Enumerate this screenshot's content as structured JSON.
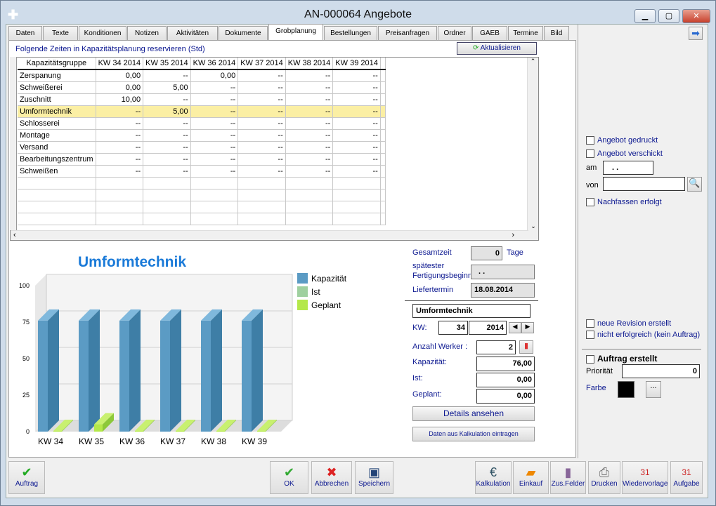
{
  "window": {
    "title": "AN-000064 Angebote"
  },
  "tabs": [
    "Daten",
    "Texte",
    "Konditionen",
    "Notizen",
    "Aktivitäten",
    "Dokumente",
    "Grobplanung",
    "Bestellungen",
    "Preisanfragen",
    "Ordner",
    "GAEB",
    "Termine",
    "Bild"
  ],
  "active_tab": "Grobplanung",
  "grob": {
    "caption": "Folgende Zeiten in Kapazitätsplanung reservieren (Std)",
    "refresh": "Aktualisieren"
  },
  "table": {
    "headers": [
      "Kapazitätsgruppe",
      "KW 34 2014",
      "KW 35 2014",
      "KW 36 2014",
      "KW 37 2014",
      "KW 38 2014",
      "KW 39 2014"
    ],
    "rows": [
      [
        "Zerspanung",
        "0,00",
        "--",
        "0,00",
        "--",
        "--",
        "--"
      ],
      [
        "Schweißerei",
        "0,00",
        "5,00",
        "--",
        "--",
        "--",
        "--"
      ],
      [
        "Zuschnitt",
        "10,00",
        "--",
        "--",
        "--",
        "--",
        "--"
      ],
      [
        "Umformtechnik",
        "--",
        "5,00",
        "--",
        "--",
        "--",
        "--"
      ],
      [
        "Schlosserei",
        "--",
        "--",
        "--",
        "--",
        "--",
        "--"
      ],
      [
        "Montage",
        "--",
        "--",
        "--",
        "--",
        "--",
        "--"
      ],
      [
        "Versand",
        "--",
        "--",
        "--",
        "--",
        "--",
        "--"
      ],
      [
        "Bearbeitungszentrum",
        "--",
        "--",
        "--",
        "--",
        "--",
        "--"
      ],
      [
        "Schweißen",
        "--",
        "--",
        "--",
        "--",
        "--",
        "--"
      ]
    ],
    "selected_row": 3
  },
  "chart_data": {
    "type": "bar",
    "title": "Umformtechnik",
    "categories": [
      "KW 34",
      "KW 35",
      "KW 36",
      "KW 37",
      "KW 38",
      "KW 39"
    ],
    "series": [
      {
        "name": "Kapazität",
        "values": [
          76,
          76,
          76,
          76,
          76,
          76
        ],
        "color": "#5b9bc4"
      },
      {
        "name": "Ist",
        "values": [
          0,
          0,
          0,
          0,
          0,
          0
        ],
        "color": "#9fd09f"
      },
      {
        "name": "Geplant",
        "values": [
          0,
          5,
          0,
          0,
          0,
          0
        ],
        "color": "#b4e84a"
      }
    ],
    "ylim": [
      0,
      100
    ],
    "yticks": [
      0,
      25,
      50,
      75,
      100
    ],
    "legend": "right"
  },
  "details": {
    "gesamtzeit_label": "Gesamtzeit",
    "gesamtzeit": "0",
    "tage": "Tage",
    "fert_label1": "spätester",
    "fert_label2": "Fertigungsbeginn",
    "fert_value": ". .",
    "liefer_label": "Liefertermin",
    "liefer_value": "18.08.2014",
    "group": "Umformtechnik",
    "kw_label": "KW:",
    "kw": "34",
    "year": "2014",
    "werker_label": "Anzahl Werker :",
    "werker": "2",
    "kap_label": "Kapazität:",
    "kap": "76,00",
    "ist_label": "Ist:",
    "ist": "0,00",
    "geplant_label": "Geplant:",
    "geplant": "0,00",
    "details_btn": "Details ansehen",
    "kalk_btn": "Daten aus Kalkulation eintragen"
  },
  "right": {
    "gedruckt": "Angebot gedruckt",
    "verschickt": "Angebot verschickt",
    "am": "am",
    "am_value": ". .",
    "von": "von",
    "nachfassen": "Nachfassen erfolgt",
    "revision": "neue Revision erstellt",
    "nicht_erfolgreich": "nicht erfolgreich (kein Auftrag)",
    "auftrag_erstellt": "Auftrag erstellt",
    "prioritaet": "Priorität",
    "prioritaet_value": "0",
    "farbe": "Farbe",
    "farbe_color": "#000000",
    "more": "..."
  },
  "toolbar": {
    "auftrag": "Auftrag",
    "ok": "OK",
    "abbrechen": "Abbrechen",
    "speichern": "Speichern",
    "kalkulation": "Kalkulation",
    "einkauf": "Einkauf",
    "zusfelder": "Zus.Felder",
    "drucken": "Drucken",
    "wiedervorlage": "Wiedervorlage",
    "aufgabe": "Aufgabe"
  }
}
